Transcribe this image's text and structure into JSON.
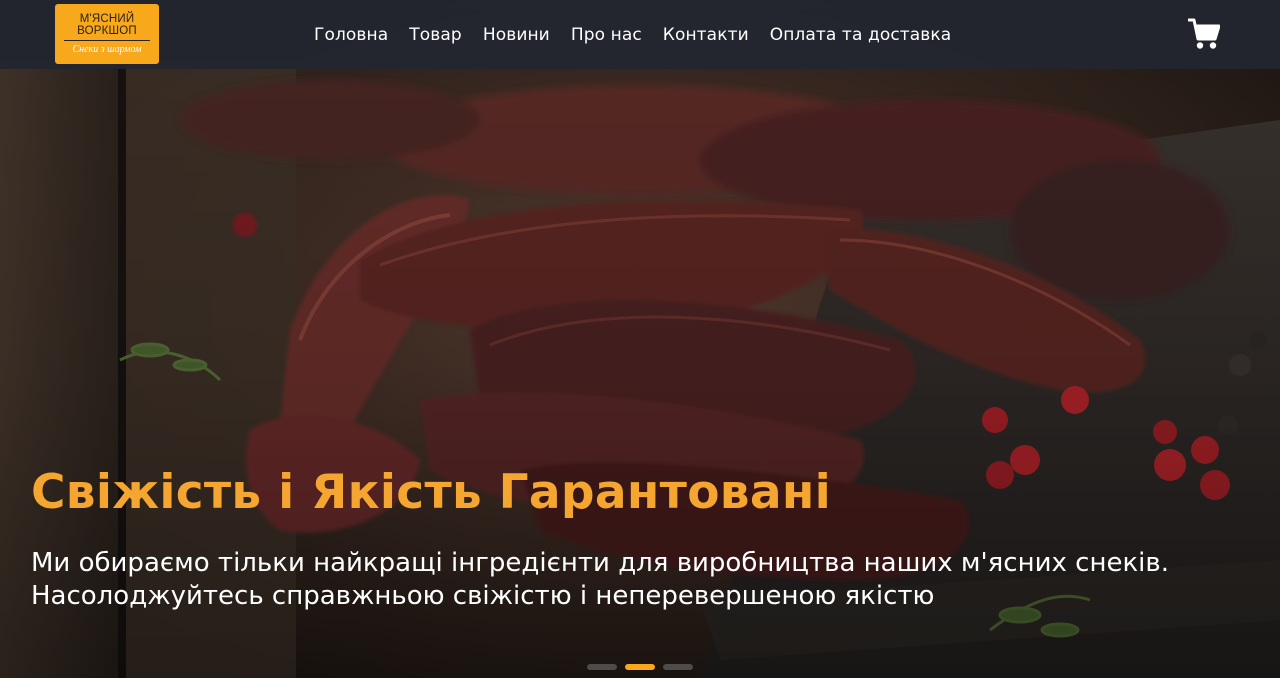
{
  "brand": {
    "name_line1": "М'ЯСНИЙ",
    "name_line2": "ВОРКШОП",
    "tagline": "Снеки з шармом"
  },
  "nav": {
    "items": [
      {
        "label": "Головна"
      },
      {
        "label": "Товар"
      },
      {
        "label": "Новини"
      },
      {
        "label": "Про нас"
      },
      {
        "label": "Контакти"
      },
      {
        "label": "Оплата та доставка"
      }
    ]
  },
  "cart": {
    "icon": "cart-icon"
  },
  "hero": {
    "title": "Свіжість і Якість Гарантовані",
    "subtitle": "Ми обираємо тільки найкращі інгредієнти для виробництва наших м'ясних снеків. Насолоджуйтесь справжньою свіжістю і неперевершеною якістю"
  },
  "carousel": {
    "slides": 3,
    "active": 2
  },
  "colors": {
    "accent": "#f7a81b",
    "title": "#f4a630",
    "header_bg": "#222630",
    "text": "#ffffff"
  }
}
